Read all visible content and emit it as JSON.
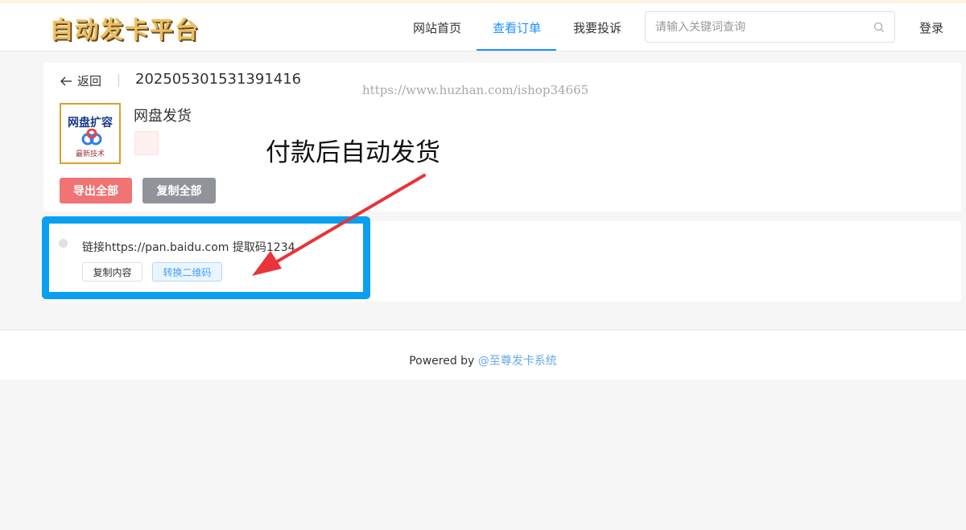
{
  "header": {
    "logo": "自动发卡平台",
    "nav": [
      {
        "label": "网站首页"
      },
      {
        "label": "查看订单"
      },
      {
        "label": "我要投诉"
      }
    ],
    "search_placeholder": "请输入关键词查询",
    "login": "登录"
  },
  "order": {
    "back_label": "返回",
    "order_no": "20250530153139141​6",
    "watermark": "https://www.huzhan.com/ishop34665",
    "product_name": "网盘发货",
    "thumb_title": "网盘扩容",
    "thumb_sub": "最新技术",
    "annotation": "付款后自动发货",
    "export_all": "导出全部",
    "copy_all": "复制全部"
  },
  "card_item": {
    "text": "链接https://pan.baidu.com 提取码1234",
    "copy_content": "复制内容",
    "convert_qr": "转换二维码"
  },
  "footer": {
    "powered_by": "Powered by ",
    "system_link": "@至尊发卡系统"
  },
  "colors": {
    "accent": "#1890ff",
    "highlight_box": "#0aa0f2",
    "arrow": "#e8343a",
    "export_button": "#f07474",
    "copy_button": "#909399"
  }
}
